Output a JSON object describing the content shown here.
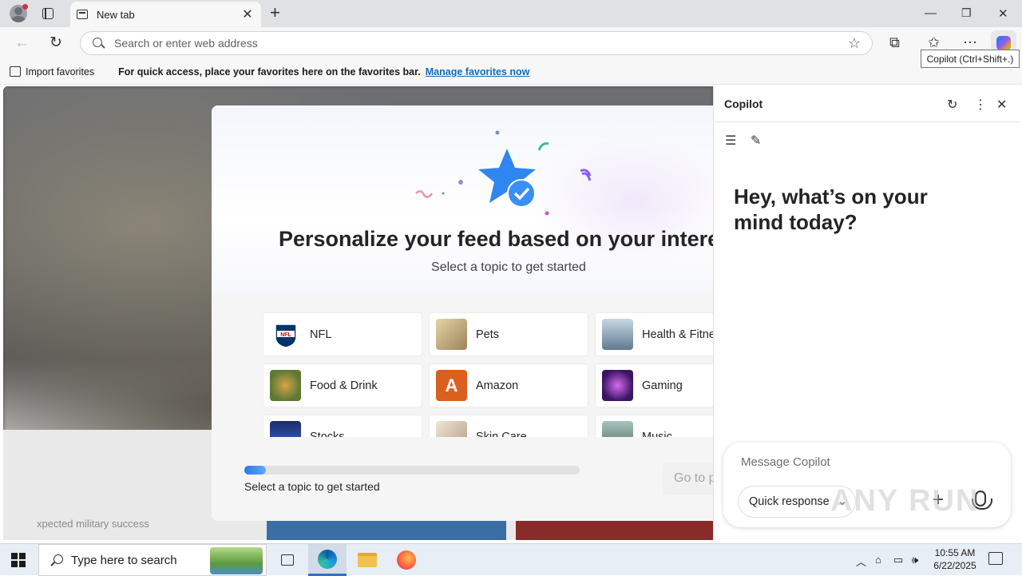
{
  "browser": {
    "tab_title": "New tab",
    "address_placeholder": "Search or enter web address",
    "tooltip": "Copilot (Ctrl+Shift+.)"
  },
  "favorites_bar": {
    "import_label": "Import favorites",
    "message": "For quick access, place your favorites here on the favorites bar.",
    "manage_link": "Manage favorites now"
  },
  "personalize": {
    "title": "Personalize your feed based on your interests",
    "subtitle": "Select a topic to get started",
    "topics": [
      {
        "label": "NFL",
        "thumb_color": "#ffffff",
        "thumb_text": ""
      },
      {
        "label": "Pets",
        "thumb_color": "#c9b28a",
        "thumb_text": ""
      },
      {
        "label": "Health & Fitness",
        "thumb_color": "#8aa1b8",
        "thumb_text": ""
      },
      {
        "label": "Food & Drink",
        "thumb_color": "#6b8a4a",
        "thumb_text": ""
      },
      {
        "label": "Amazon",
        "thumb_color": "#d9601f",
        "thumb_text": "A"
      },
      {
        "label": "Gaming",
        "thumb_color": "#4b1d74",
        "thumb_text": ""
      },
      {
        "label": "Stocks",
        "thumb_color": "#1f3f8a",
        "thumb_text": ""
      },
      {
        "label": "Skin Care",
        "thumb_color": "#d8c7b4",
        "thumb_text": ""
      },
      {
        "label": "Music",
        "thumb_color": "#6a8f8a",
        "thumb_text": ""
      }
    ],
    "progress_fraction": 0.065,
    "progress_text": "Select a topic to get started",
    "go_button": "Go to p"
  },
  "background": {
    "partial_headline": "xpected military success"
  },
  "copilot": {
    "title": "Copilot",
    "greeting": "Hey, what’s on your mind today?",
    "message_placeholder": "Message Copilot",
    "mode_label": "Quick response"
  },
  "watermark": "ANY RUN",
  "taskbar": {
    "search_placeholder": "Type here to search",
    "time": "10:55 AM",
    "date": "6/22/2025"
  }
}
